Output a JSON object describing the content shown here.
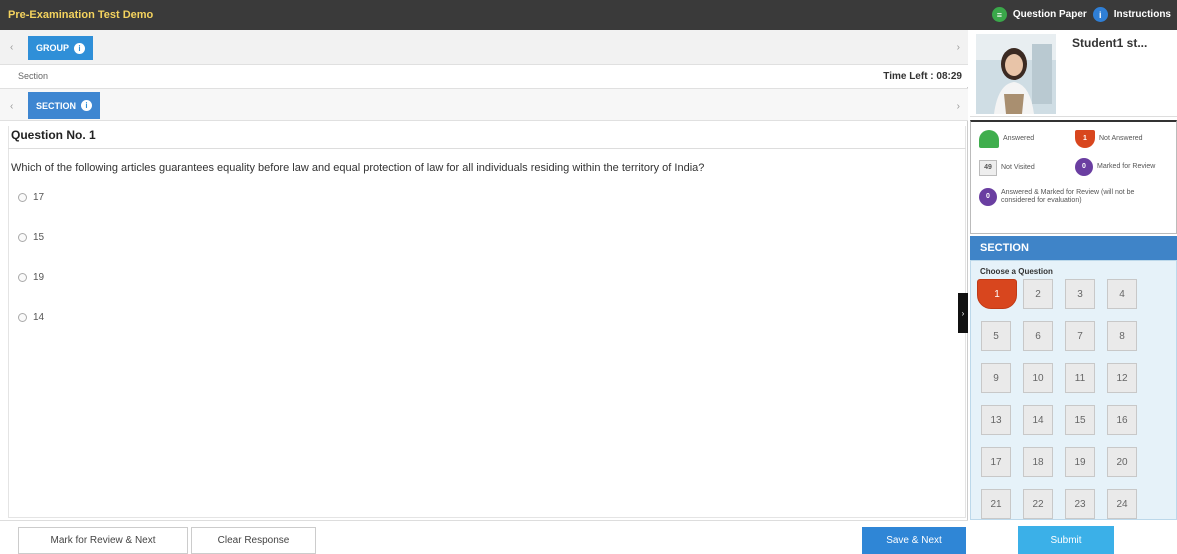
{
  "topbar": {
    "title": "Pre-Examination Test Demo",
    "question_paper": "Question Paper",
    "instructions": "Instructions"
  },
  "group": {
    "label": "GROUP",
    "info": "i"
  },
  "section_label": "Section",
  "time_left": "Time Left : 08:29",
  "section_tab": {
    "label": "SECTION",
    "info": "i"
  },
  "question": {
    "number_label": "Question No. 1",
    "text": "Which of the following articles guarantees equality before law and equal protection of law for all individuals residing within the territory of India?",
    "options": [
      "17",
      "15",
      "19",
      "14"
    ]
  },
  "buttons": {
    "mark_review": "Mark for Review & Next",
    "clear": "Clear Response",
    "save_next": "Save & Next",
    "submit": "Submit"
  },
  "student": {
    "name": "Student1 st..."
  },
  "legend": {
    "answered": "Answered",
    "not_answered": "Not Answered",
    "not_answered_count": "1",
    "not_visited": "Not Visited",
    "not_visited_count": "49",
    "marked": "Marked for Review",
    "marked_count": "0",
    "answered_marked": "Answered & Marked for Review (will not be considered for evaluation)",
    "answered_marked_count": "0"
  },
  "palette": {
    "section_title": "SECTION",
    "choose_label": "Choose a Question",
    "current": 1,
    "numbers": [
      "1",
      "2",
      "3",
      "4",
      "5",
      "6",
      "7",
      "8",
      "9",
      "10",
      "11",
      "12",
      "13",
      "14",
      "15",
      "16",
      "17",
      "18",
      "19",
      "20",
      "21",
      "22",
      "23",
      "24"
    ]
  },
  "colors": {
    "topbar": "#3a3a3a",
    "accent_blue": "#2f86d6",
    "not_answered": "#d8461e",
    "answered": "#3fae4d",
    "marked": "#6a3ea1"
  }
}
